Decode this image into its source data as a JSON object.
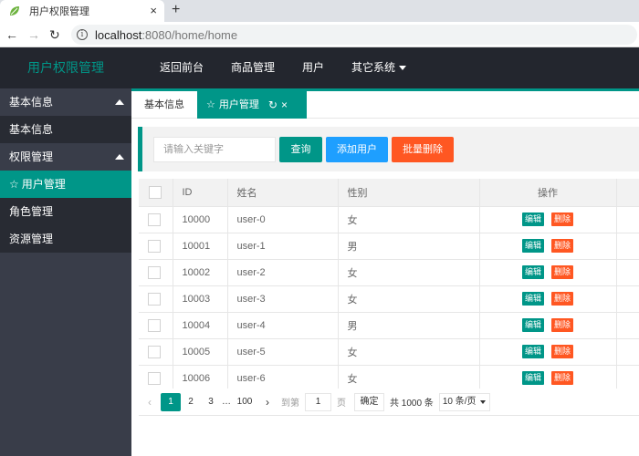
{
  "browser": {
    "tab_title": "用户权限管理",
    "new_tab": "+",
    "close_tab": "×",
    "url_host": "localhost",
    "url_rest": ":8080/home/home"
  },
  "header": {
    "logo": "用户权限管理",
    "nav": [
      "返回前台",
      "商品管理",
      "用户",
      "其它系统"
    ]
  },
  "sidebar": {
    "group1": "基本信息",
    "group1_items": [
      "基本信息"
    ],
    "group2": "权限管理",
    "group2_items": [
      "用户管理",
      "角色管理",
      "资源管理"
    ]
  },
  "tabs": {
    "home": "基本信息",
    "current": "用户管理"
  },
  "toolbar": {
    "search_placeholder": "请输入关键字",
    "query": "查询",
    "add": "添加用户",
    "batch_delete": "批量删除"
  },
  "table": {
    "headers": [
      "ID",
      "姓名",
      "性别",
      "操作"
    ],
    "edit_label": "编辑",
    "delete_label": "删除",
    "rows": [
      {
        "id": "10000",
        "name": "user-0",
        "sex": "女"
      },
      {
        "id": "10001",
        "name": "user-1",
        "sex": "男"
      },
      {
        "id": "10002",
        "name": "user-2",
        "sex": "女"
      },
      {
        "id": "10003",
        "name": "user-3",
        "sex": "女"
      },
      {
        "id": "10004",
        "name": "user-4",
        "sex": "男"
      },
      {
        "id": "10005",
        "name": "user-5",
        "sex": "女"
      },
      {
        "id": "10006",
        "name": "user-6",
        "sex": "女"
      }
    ]
  },
  "pager": {
    "current": "1",
    "pages": [
      "2",
      "3"
    ],
    "ellipsis": "…",
    "last": "100",
    "goto": "到第",
    "goto_value": "1",
    "page_unit": "页",
    "confirm": "确定",
    "total": "共 1000 条",
    "page_size": "10 条/页"
  },
  "colors": {
    "accent": "#009688",
    "header_bg": "#23262e",
    "sidebar_bg": "#393d49",
    "blue": "#1e9fff",
    "orange": "#ff5722"
  }
}
